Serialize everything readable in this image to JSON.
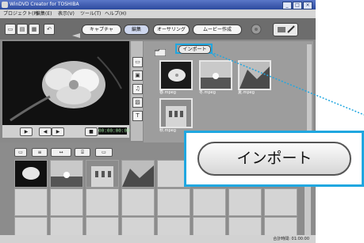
{
  "window": {
    "title": "WinDVD Creator for TOSHIBA",
    "controls": [
      "_",
      "□",
      "×"
    ]
  },
  "menu": [
    "プロジェクト(P)",
    "編集(E)",
    "表示(V)",
    "ツール(T)",
    "ヘルプ(H)"
  ],
  "toolbar": {
    "buttons": [
      "new",
      "open",
      "save",
      "undo"
    ],
    "tabs": [
      {
        "label": "キャプチャ",
        "active": false
      },
      {
        "label": "編集",
        "active": true
      },
      {
        "label": "オーサリング",
        "active": false
      },
      {
        "label": "ムービー作成",
        "active": false
      }
    ]
  },
  "preview": {
    "timecode": "00:00:00:00"
  },
  "library": {
    "import_label": "インポート",
    "items": [
      {
        "label": "春.mpeg",
        "scene": "flower"
      },
      {
        "label": "冬.mpeg",
        "scene": "sunset"
      },
      {
        "label": "夏.mpeg",
        "scene": "cliff"
      },
      {
        "label": "秋.mpeg",
        "scene": "building"
      }
    ]
  },
  "timeline": {
    "clips": [
      "flower",
      "sunset",
      "building",
      "cliff"
    ],
    "total_time_label": "合計時間: 01:00:00"
  },
  "callout": {
    "label": "インポート"
  },
  "colors": {
    "highlight": "#20a7e0",
    "title_bar": "#2c4a9e"
  }
}
